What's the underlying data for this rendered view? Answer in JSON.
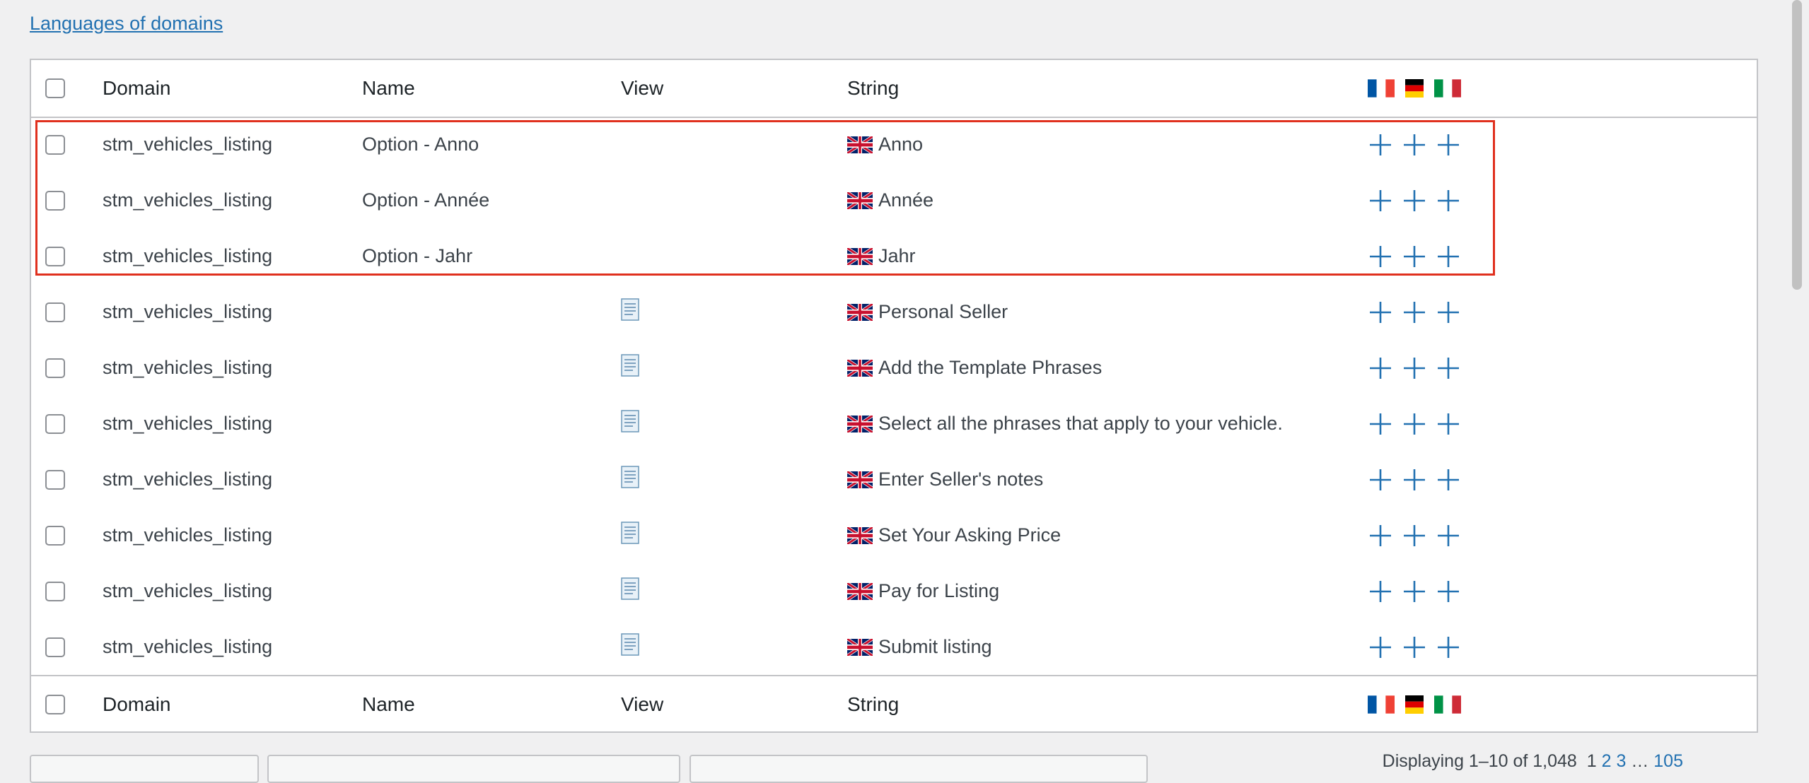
{
  "top_link": "Languages of domains",
  "columns": {
    "domain": "Domain",
    "name": "Name",
    "view": "View",
    "string": "String"
  },
  "languages": [
    "French",
    "German",
    "Italian"
  ],
  "rows": [
    {
      "domain": "stm_vehicles_listing",
      "name": "Option - Anno",
      "has_view": false,
      "string": "Anno"
    },
    {
      "domain": "stm_vehicles_listing",
      "name": "Option - Année",
      "has_view": false,
      "string": "Année"
    },
    {
      "domain": "stm_vehicles_listing",
      "name": "Option - Jahr",
      "has_view": false,
      "string": "Jahr"
    },
    {
      "domain": "stm_vehicles_listing",
      "name": "",
      "has_view": true,
      "string": "Personal Seller"
    },
    {
      "domain": "stm_vehicles_listing",
      "name": "",
      "has_view": true,
      "string": "Add the Template Phrases"
    },
    {
      "domain": "stm_vehicles_listing",
      "name": "",
      "has_view": true,
      "string": "Select all the phrases that apply to your vehicle."
    },
    {
      "domain": "stm_vehicles_listing",
      "name": "",
      "has_view": true,
      "string": "Enter Seller's notes"
    },
    {
      "domain": "stm_vehicles_listing",
      "name": "",
      "has_view": true,
      "string": "Set Your Asking Price"
    },
    {
      "domain": "stm_vehicles_listing",
      "name": "",
      "has_view": true,
      "string": "Pay for Listing"
    },
    {
      "domain": "stm_vehicles_listing",
      "name": "",
      "has_view": true,
      "string": "Submit listing"
    }
  ],
  "pagination": {
    "text": "Displaying 1–10 of 1,048",
    "current": "1",
    "pages": [
      "2",
      "3"
    ],
    "ellipsis": "…",
    "last": "105"
  },
  "colors": {
    "link": "#2271b1",
    "highlight": "#e0301e",
    "plus": "#2271b1"
  }
}
